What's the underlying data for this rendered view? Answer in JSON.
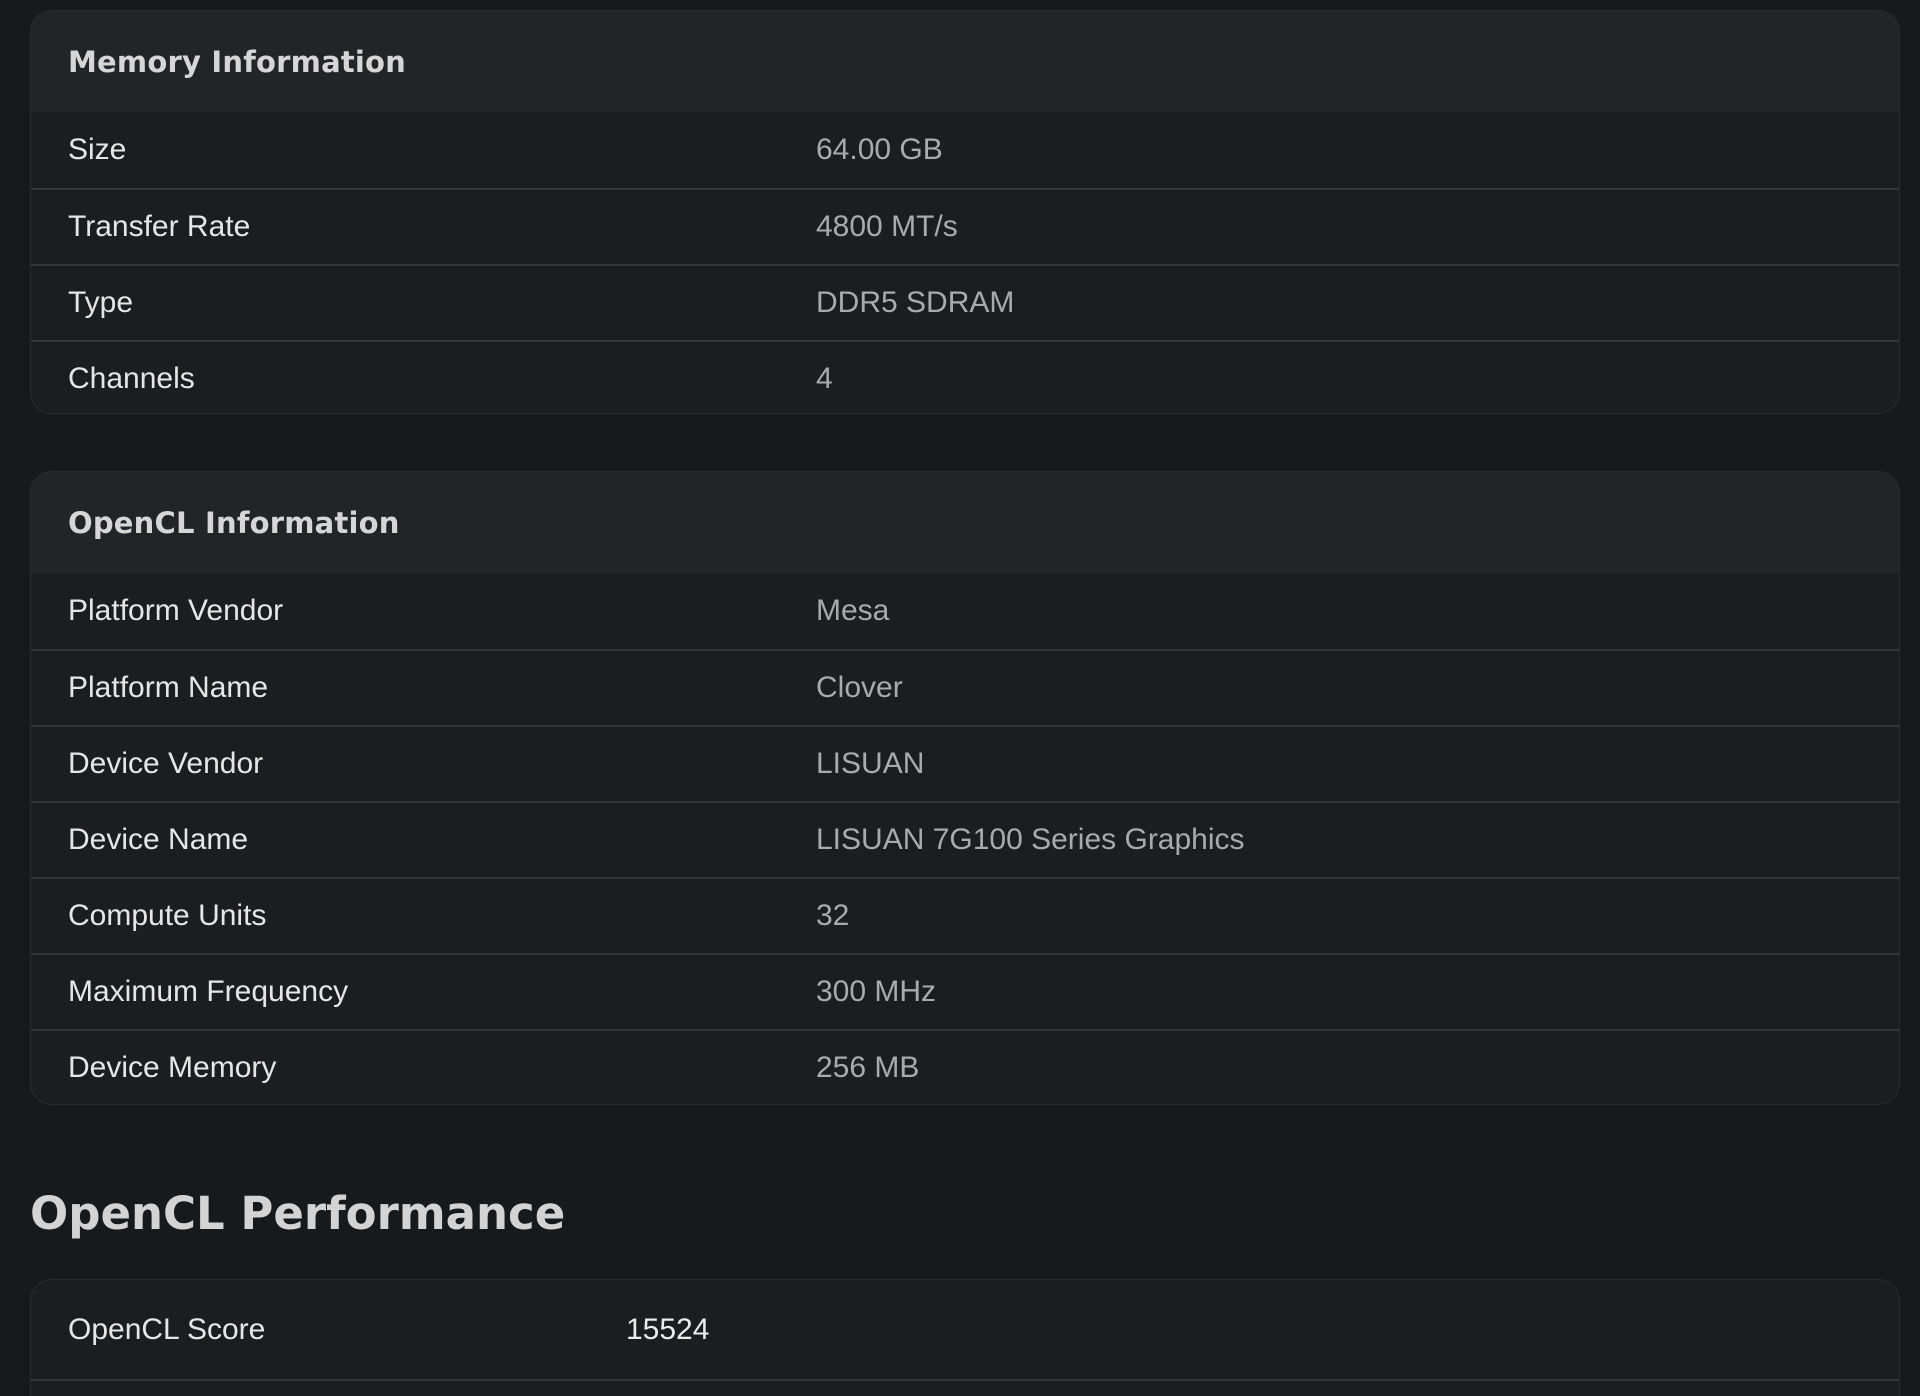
{
  "memory": {
    "title": "Memory Information",
    "rows": [
      {
        "label": "Size",
        "value": "64.00 GB"
      },
      {
        "label": "Transfer Rate",
        "value": "4800 MT/s"
      },
      {
        "label": "Type",
        "value": "DDR5 SDRAM"
      },
      {
        "label": "Channels",
        "value": "4"
      }
    ]
  },
  "opencl": {
    "title": "OpenCL Information",
    "rows": [
      {
        "label": "Platform Vendor",
        "value": "Mesa"
      },
      {
        "label": "Platform Name",
        "value": "Clover"
      },
      {
        "label": "Device Vendor",
        "value": "LISUAN"
      },
      {
        "label": "Device Name",
        "value": "LISUAN 7G100 Series Graphics"
      },
      {
        "label": "Compute Units",
        "value": "32"
      },
      {
        "label": "Maximum Frequency",
        "value": "300 MHz"
      },
      {
        "label": "Device Memory",
        "value": "256 MB"
      }
    ]
  },
  "performance": {
    "title": "OpenCL Performance",
    "rows": [
      {
        "label": "OpenCL Score",
        "value": "15524"
      }
    ]
  },
  "colors": {
    "background": "#18191b",
    "card": "#1c1d1f",
    "card_header": "#232428",
    "divider": "#35363a",
    "label_text": "#e6e6e6",
    "value_text": "#a9aaac"
  }
}
